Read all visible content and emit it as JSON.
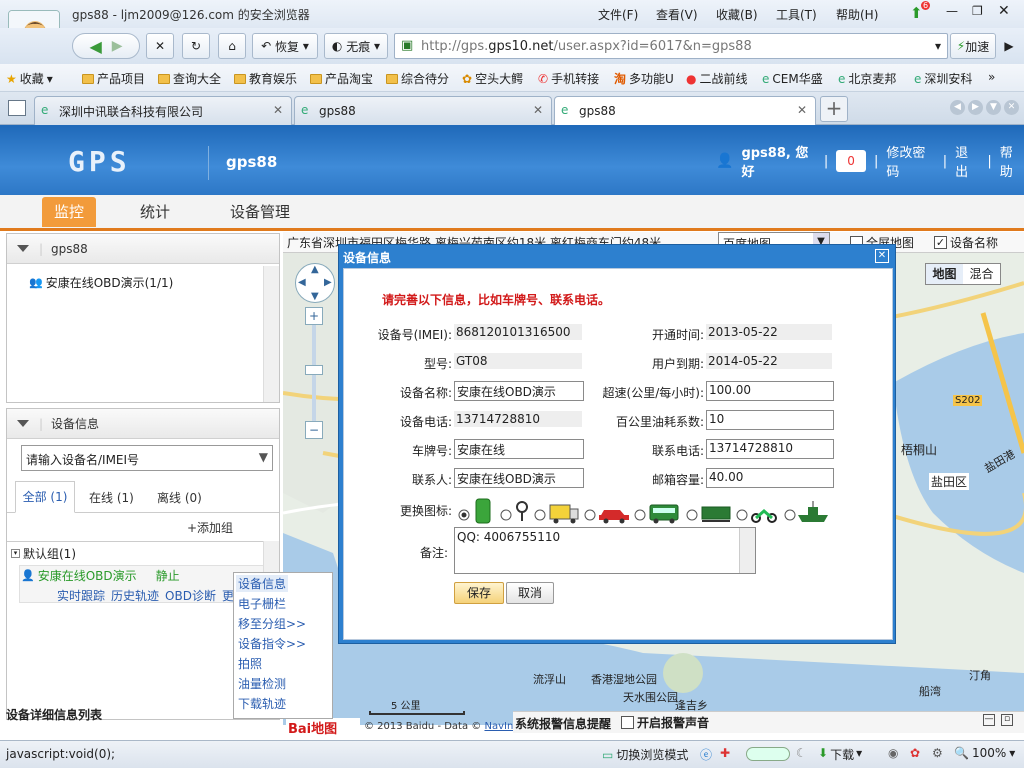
{
  "browser": {
    "window_title": "gps88 - ljm2009@126.com 的安全浏览器",
    "menu": [
      "文件(F)",
      "查看(V)",
      "收藏(B)",
      "工具(T)",
      "帮助(H)"
    ],
    "notify_count": "6",
    "nav": {
      "restore": "恢复",
      "incognito": "无痕",
      "speedup": "加速"
    },
    "url_prefix": "http://gps.",
    "url_domain": "gps10.net",
    "url_rest": "/user.aspx?id=6017&n=gps88",
    "bookmarks": [
      "收藏",
      "产品项目",
      "查询大全",
      "教育娱乐",
      "产品淘宝",
      "综合待分",
      "空头大鳄",
      "手机转接",
      "多功能U",
      "二战前线",
      "CEM华盛",
      "北京麦邦",
      "深圳安科"
    ],
    "tabs": [
      "深圳中讯联合科技有限公司",
      "gps88",
      "gps88"
    ],
    "status_left": "javascript:void(0);",
    "status_mode": "切换浏览模式",
    "status_download": "下载",
    "zoom": "100%"
  },
  "app": {
    "logo": "GPS",
    "account_name": "gps88",
    "greeting": "gps88, 您好",
    "alert_count": "0",
    "links": [
      "修改密码",
      "退出",
      "帮助"
    ],
    "tabs": [
      "监控",
      "统计",
      "设备管理"
    ],
    "active_tab": "监控"
  },
  "left": {
    "tree_title": "gps88",
    "tree_item": "安康在线OBD演示(1/1)",
    "device_panel_title": "设备信息",
    "search_placeholder": "请输入设备名/IMEI号",
    "filters": [
      "全部 (1)",
      "在线 (1)",
      "离线 (0)"
    ],
    "add_group": "+添加组",
    "group": "默认组(1)",
    "device_name": "安康在线OBD演示",
    "device_state": "静止",
    "device_links": [
      "实时跟踪",
      "历史轨迹",
      "OBD诊断",
      "更多"
    ],
    "footer": "设备详细信息列表"
  },
  "context_menu": [
    "设备信息",
    "电子栅栏",
    "移至分组>>",
    "设备指令>>",
    "拍照",
    "油量检测",
    "下载轨迹"
  ],
  "map": {
    "address": "广东省深圳市福田区梅华路,离梅兴苑南区约18米,离红梅商东门约48米",
    "map_source": "百度地图",
    "fullscreen": "全屏地图",
    "show_names": "设备名称",
    "mode_map": "地图",
    "mode_mix": "混合",
    "places": [
      "S202",
      "梧桐山",
      "盐田区",
      "盐田港",
      "流浮山",
      "香港湿地公园",
      "天水围公园",
      "逢吉乡",
      "汀角",
      "船湾",
      "步"
    ],
    "scale": "5 公里",
    "copyright": "© 2013 Baidu - Data ©",
    "navinfo": "NavInfo",
    "baidu": "Bai地图",
    "alarm": "系统报警信息提醒",
    "alarm_sound": "开启报警声音"
  },
  "dialog": {
    "title": "设备信息",
    "notice": "请完善以下信息，比如车牌号、联系电话。",
    "imei_label": "设备号(IMEI):",
    "imei": "868120101316500",
    "model_label": "型号:",
    "model": "GT08",
    "name_label": "设备名称:",
    "name": "安康在线OBD演示",
    "phone_label": "设备电话:",
    "phone": "13714728810",
    "plate_label": "车牌号:",
    "plate": "安康在线",
    "contact_label": "联系人:",
    "contact": "安康在线OBD演示",
    "open_label": "开通时间:",
    "open": "2013-05-22",
    "expire_label": "用户到期:",
    "expire": "2014-05-22",
    "speed_label": "超速(公里/每小时):",
    "speed": "100.00",
    "fuel_label": "百公里油耗系数:",
    "fuel": "10",
    "contact_phone_label": "联系电话:",
    "contact_phone": "13714728810",
    "tank_label": "邮箱容量:",
    "tank": "40.00",
    "icon_label": "更换图标:",
    "icon_options": [
      "person-icon",
      "pin-icon",
      "truck-icon",
      "car-icon",
      "bus-icon",
      "train-icon",
      "motorcycle-icon",
      "ship-icon"
    ],
    "selected_icon": 0,
    "remark_label": "备注:",
    "remark": "QQ: 4006755110",
    "save": "保存",
    "cancel": "取消"
  },
  "colors": {
    "header_blue": "#2d77c6",
    "accent_orange": "#f29b3b",
    "dialog_blue": "#2d80cf",
    "notice_red": "#d21a1a",
    "link_blue": "#2a5db0",
    "online_green": "#2a9a2a"
  }
}
